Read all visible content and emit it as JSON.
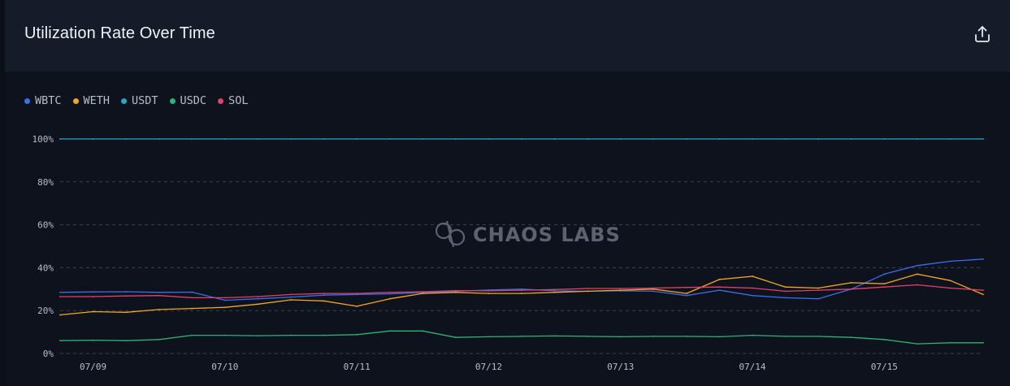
{
  "header": {
    "title": "Utilization Rate Over Time",
    "export_icon": "share-export-icon"
  },
  "watermark": "CHAOS LABS",
  "colors": {
    "WBTC": "#3b6ee8",
    "WETH": "#f5a623",
    "USDT": "#26a8c4",
    "USDC": "#2fb36f",
    "SOL": "#e0426e",
    "grid": "#3a404d",
    "background": "#0d121d"
  },
  "chart_data": {
    "type": "line",
    "title": "Utilization Rate Over Time",
    "xlabel": "",
    "ylabel": "",
    "x_ticks": [
      "07/09",
      "07/10",
      "07/11",
      "07/12",
      "07/13",
      "07/14",
      "07/15"
    ],
    "y_ticks": [
      "0%",
      "20%",
      "40%",
      "60%",
      "80%",
      "100%"
    ],
    "ylim": [
      0,
      100
    ],
    "grid": true,
    "legend_position": "top-left",
    "x": [
      "07/08 18:00",
      "07/09 00:00",
      "07/09 06:00",
      "07/09 12:00",
      "07/09 18:00",
      "07/10 00:00",
      "07/10 06:00",
      "07/10 12:00",
      "07/10 18:00",
      "07/11 00:00",
      "07/11 06:00",
      "07/11 12:00",
      "07/11 18:00",
      "07/12 00:00",
      "07/12 06:00",
      "07/12 12:00",
      "07/12 18:00",
      "07/13 00:00",
      "07/13 06:00",
      "07/13 12:00",
      "07/13 18:00",
      "07/14 00:00",
      "07/14 06:00",
      "07/14 12:00",
      "07/14 18:00",
      "07/15 00:00",
      "07/15 06:00",
      "07/15 12:00",
      "07/15 15:00"
    ],
    "series": [
      {
        "name": "WBTC",
        "values": [
          28.5,
          28.7,
          28.8,
          28.5,
          28.6,
          24.8,
          25.5,
          26.3,
          27.2,
          27.5,
          27.8,
          28.4,
          29.0,
          29.6,
          30.0,
          29.2,
          29.0,
          29.2,
          29.0,
          27.0,
          29.5,
          27.0,
          26.0,
          25.5,
          30.0,
          37.0,
          41.0,
          43.0,
          44.0
        ]
      },
      {
        "name": "WETH",
        "values": [
          18.0,
          19.5,
          19.2,
          20.5,
          21.0,
          21.5,
          23.0,
          25.0,
          24.5,
          22.0,
          25.5,
          28.0,
          28.5,
          28.0,
          28.0,
          28.5,
          29.0,
          29.5,
          30.0,
          28.0,
          34.5,
          36.0,
          31.0,
          30.5,
          33.0,
          32.5,
          37.0,
          34.0,
          27.5
        ]
      },
      {
        "name": "USDT",
        "values": [
          100,
          100,
          100,
          100,
          100,
          100,
          100,
          100,
          100,
          100,
          100,
          100,
          100,
          100,
          100,
          100,
          100,
          100,
          100,
          100,
          100,
          100,
          100,
          100,
          100,
          100,
          100,
          100,
          100
        ]
      },
      {
        "name": "USDC",
        "values": [
          6.0,
          6.2,
          6.0,
          6.5,
          8.5,
          8.5,
          8.3,
          8.5,
          8.5,
          8.8,
          10.5,
          10.5,
          7.5,
          7.8,
          8.0,
          8.2,
          8.0,
          7.8,
          8.0,
          8.0,
          7.8,
          8.5,
          8.0,
          8.0,
          7.5,
          6.5,
          4.5,
          5.0,
          5.0
        ]
      },
      {
        "name": "SOL",
        "values": [
          26.5,
          26.5,
          26.8,
          27.0,
          26.0,
          26.0,
          26.5,
          27.5,
          28.0,
          28.0,
          28.5,
          28.8,
          29.3,
          29.2,
          29.5,
          29.8,
          30.3,
          30.3,
          30.5,
          30.8,
          31.0,
          30.5,
          29.0,
          29.5,
          30.0,
          31.0,
          32.0,
          30.5,
          29.5
        ]
      }
    ]
  }
}
